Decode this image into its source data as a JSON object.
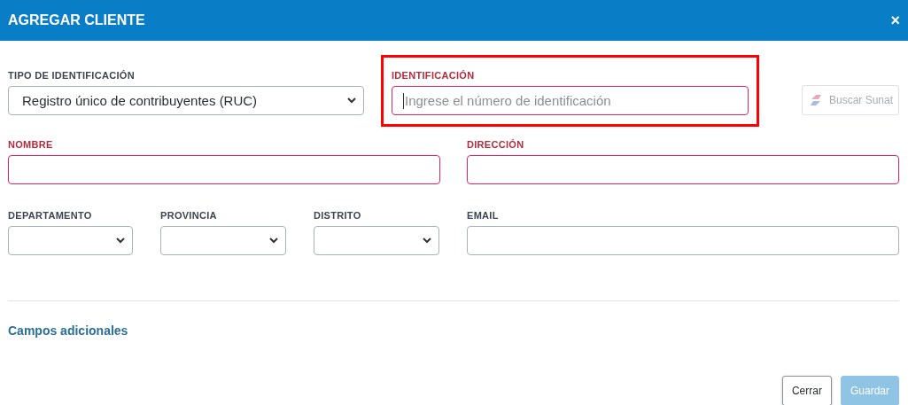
{
  "dialog": {
    "title": "AGREGAR CLIENTE",
    "close": "×"
  },
  "rows": [
    [
      {
        "kind": "select",
        "label": "TIPO DE IDENTIFICACIÓN",
        "value": "Registro único de contribuyentes (RUC)",
        "required": false,
        "highlighted": false
      },
      {
        "kind": "input",
        "label": "IDENTIFICACIÓN",
        "placeholder": "Ingrese el número de identificación",
        "required": true,
        "highlighted": true,
        "focused": true
      }
    ],
    [
      {
        "kind": "input",
        "label": "NOMBRE",
        "required": true,
        "highlighted": false,
        "focused": false
      },
      {
        "kind": "input",
        "label": "DIRECCIÓN",
        "required": true,
        "highlighted": false,
        "focused": false
      }
    ],
    [
      {
        "kind": "select",
        "label": "DEPARTAMENTO",
        "required": false,
        "highlighted": false
      },
      {
        "kind": "select",
        "label": "PROVINCIA",
        "required": false,
        "highlighted": false
      },
      {
        "kind": "select",
        "label": "DISTRITO",
        "required": false,
        "highlighted": false
      },
      {
        "kind": "input",
        "label": "EMAIL",
        "required": false,
        "highlighted": false,
        "focused": false
      }
    ]
  ],
  "lookup_button": {
    "label": "Buscar Sunat",
    "disabled": true
  },
  "section_link": "Campos adicionales",
  "buttons": [
    {
      "label": "Cerrar",
      "kind": "secondary",
      "disabled": false
    },
    {
      "label": "Guardar",
      "kind": "primary",
      "disabled": true
    }
  ]
}
